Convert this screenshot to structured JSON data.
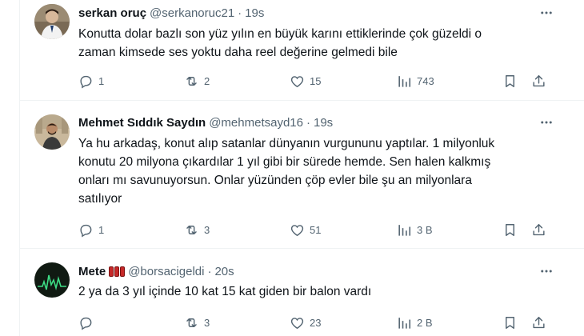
{
  "tweets": [
    {
      "name": "serkan oruç",
      "handle": "@serkanoruc21",
      "time": "19s",
      "text": "Konutta dolar bazlı son yüz yılın en büyük karını ettiklerinde çok güzeldi o\nzaman kimsede ses yoktu daha reel değerine gelmedi bile",
      "replies": "1",
      "retweets": "2",
      "likes": "15",
      "views": "743"
    },
    {
      "name": "Mehmet Sıddık Saydın",
      "handle": "@mehmetsayd16",
      "time": "19s",
      "text": "Ya hu arkadaş, konut alıp satanlar dünyanın vurgununu yaptılar. 1 milyonluk\nkonutu 20 milyona çıkardılar 1 yıl gibi bir sürede hemde. Sen halen kalkmış\nonları mı savunuyorsun. Onlar yüzünden çöp evler bile şu an milyonlara\nsatılıyor",
      "replies": "1",
      "retweets": "3",
      "likes": "51",
      "views": "3 B"
    },
    {
      "name": "Mete",
      "handle": "@borsacigeldi",
      "time": "20s",
      "text": "2 ya da 3 yıl içinde 10 kat 15 kat giden bir balon vardı",
      "replies": "",
      "retweets": "3",
      "likes": "23",
      "views": "2 B"
    }
  ],
  "separator": "·",
  "icons": [
    "more-icon",
    "reply-icon",
    "retweet-icon",
    "like-icon",
    "views-icon",
    "bookmark-icon",
    "share-icon"
  ],
  "colors": {
    "text": "#0f1419",
    "secondary": "#536471",
    "border": "#eff3f4"
  }
}
